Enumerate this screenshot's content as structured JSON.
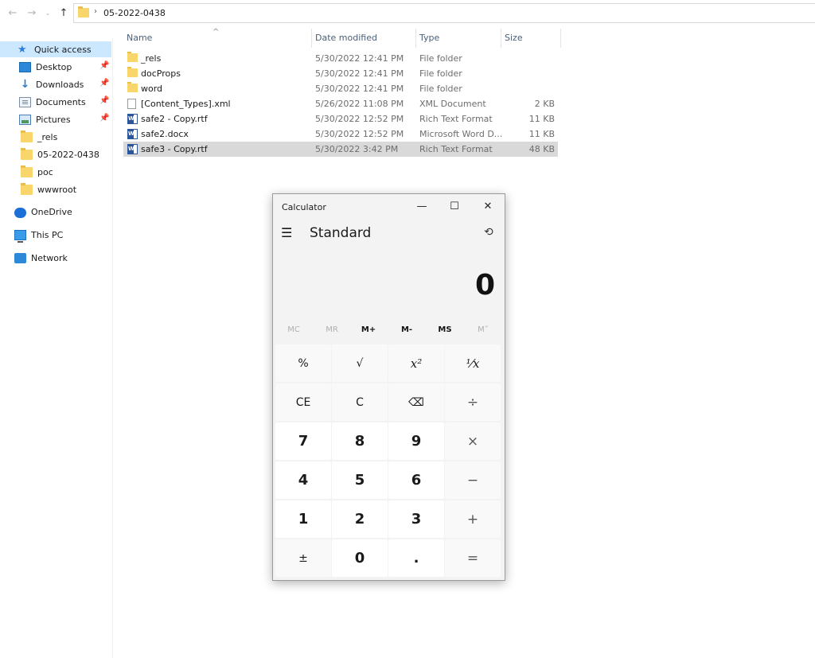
{
  "address": {
    "back_icon": "arrow-left-icon",
    "forward_icon": "arrow-right-icon",
    "recent_icon": "chevron-down-icon",
    "up_icon": "arrow-up-icon",
    "path": "05-2022-0438"
  },
  "nav": {
    "items": [
      {
        "label": "Quick access",
        "icon": "star-icon",
        "selected": true
      },
      {
        "label": "Desktop",
        "icon": "desktop-icon",
        "pinned": true
      },
      {
        "label": "Downloads",
        "icon": "download-icon",
        "pinned": true
      },
      {
        "label": "Documents",
        "icon": "documents-icon",
        "pinned": true
      },
      {
        "label": "Pictures",
        "icon": "pictures-icon",
        "pinned": true
      },
      {
        "label": "_rels",
        "icon": "folder-icon"
      },
      {
        "label": "05-2022-0438",
        "icon": "folder-icon"
      },
      {
        "label": "poc",
        "icon": "folder-icon"
      },
      {
        "label": "wwwroot",
        "icon": "folder-icon"
      },
      {
        "label": "OneDrive",
        "icon": "cloud-icon"
      },
      {
        "label": "This PC",
        "icon": "computer-icon"
      },
      {
        "label": "Network",
        "icon": "network-icon"
      }
    ]
  },
  "files": {
    "columns": {
      "name": "Name",
      "date": "Date modified",
      "type": "Type",
      "size": "Size"
    },
    "rows": [
      {
        "name": "_rels",
        "date": "5/30/2022 12:41 PM",
        "type": "File folder",
        "size": "",
        "icon": "folder-icon"
      },
      {
        "name": "docProps",
        "date": "5/30/2022 12:41 PM",
        "type": "File folder",
        "size": "",
        "icon": "folder-icon"
      },
      {
        "name": "word",
        "date": "5/30/2022 12:41 PM",
        "type": "File folder",
        "size": "",
        "icon": "folder-icon"
      },
      {
        "name": "[Content_Types].xml",
        "date": "5/26/2022 11:08 PM",
        "type": "XML Document",
        "size": "2 KB",
        "icon": "xml-file-icon"
      },
      {
        "name": "safe2 - Copy.rtf",
        "date": "5/30/2022 12:52 PM",
        "type": "Rich Text Format",
        "size": "11 KB",
        "icon": "word-file-icon"
      },
      {
        "name": "safe2.docx",
        "date": "5/30/2022 12:52 PM",
        "type": "Microsoft Word D...",
        "size": "11 KB",
        "icon": "word-file-icon"
      },
      {
        "name": "safe3 - Copy.rtf",
        "date": "5/30/2022 3:42 PM",
        "type": "Rich Text Format",
        "size": "48 KB",
        "icon": "word-file-icon",
        "selected": true
      }
    ]
  },
  "calculator": {
    "title": "Calculator",
    "mode": "Standard",
    "display": "0",
    "window_controls": {
      "minimize": "—",
      "maximize": "☐",
      "close": "✕"
    },
    "memory": [
      {
        "label": "MC",
        "enabled": false
      },
      {
        "label": "MR",
        "enabled": false
      },
      {
        "label": "M+",
        "enabled": true
      },
      {
        "label": "M-",
        "enabled": true
      },
      {
        "label": "MS",
        "enabled": true
      },
      {
        "label": "M˅",
        "enabled": false
      }
    ],
    "keys": [
      [
        "%",
        "√",
        "x²",
        "⅟x"
      ],
      [
        "CE",
        "C",
        "⌫",
        "÷"
      ],
      [
        "7",
        "8",
        "9",
        "×"
      ],
      [
        "4",
        "5",
        "6",
        "−"
      ],
      [
        "1",
        "2",
        "3",
        "+"
      ],
      [
        "±",
        "0",
        ".",
        "="
      ]
    ]
  }
}
